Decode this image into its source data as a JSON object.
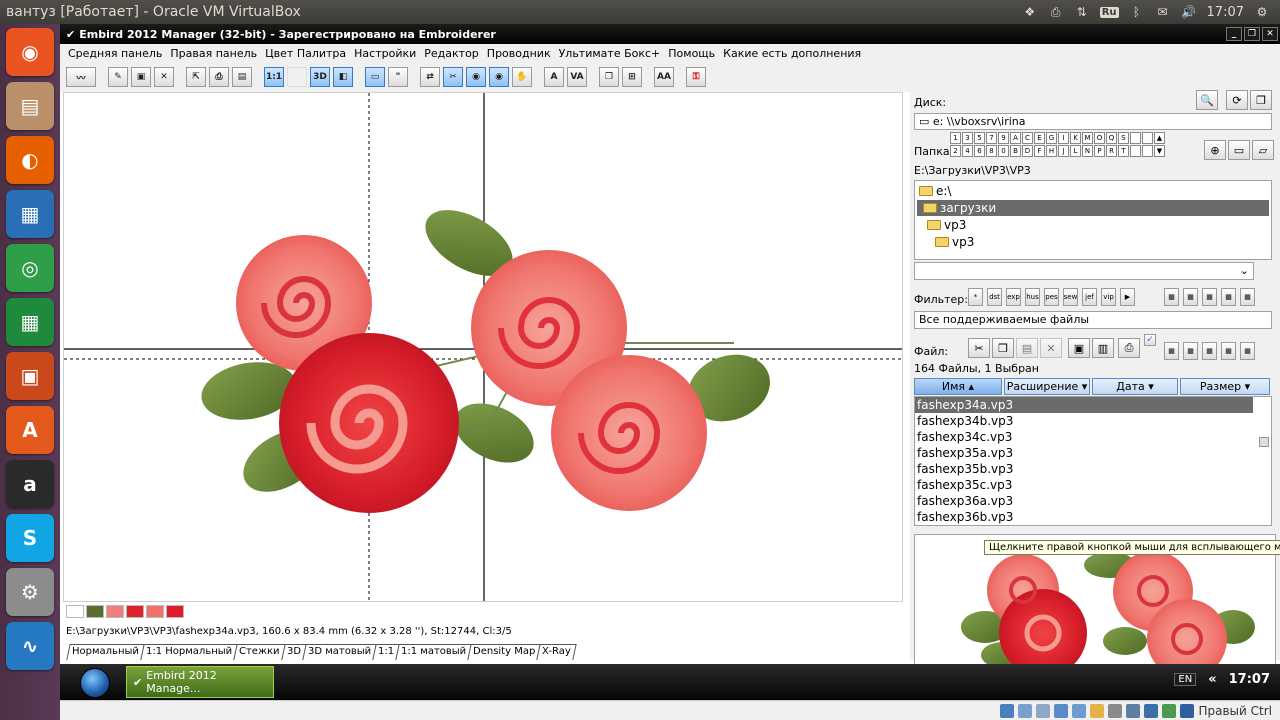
{
  "host": {
    "window_title": "вантуз [Работает] - Oracle VM VirtualBox",
    "keyboard_layout": "Ru",
    "clock": "17:07",
    "launcher_items": [
      {
        "name": "ubuntu-dash-icon",
        "color": "#e95420",
        "glyph": "◉"
      },
      {
        "name": "files-icon",
        "color": "#b9906a",
        "glyph": "▤"
      },
      {
        "name": "firefox-icon",
        "color": "#e66000",
        "glyph": "◐"
      },
      {
        "name": "writer-icon",
        "color": "#2a6fb5",
        "glyph": "▦"
      },
      {
        "name": "chrome-icon",
        "color": "#2e9e48",
        "glyph": "◎"
      },
      {
        "name": "calc-icon",
        "color": "#1f8a3c",
        "glyph": "▦"
      },
      {
        "name": "impress-icon",
        "color": "#c9481c",
        "glyph": "▣"
      },
      {
        "name": "software-center-icon",
        "color": "#e45a1c",
        "glyph": "A"
      },
      {
        "name": "amazon-icon",
        "color": "#2a2a2a",
        "glyph": "a"
      },
      {
        "name": "skype-icon",
        "color": "#12a5e6",
        "glyph": "S"
      },
      {
        "name": "settings-icon",
        "color": "#8c8c8c",
        "glyph": "⚙"
      },
      {
        "name": "monitor-icon",
        "color": "#2579c2",
        "glyph": "∿"
      }
    ]
  },
  "app": {
    "title": "Embird 2012 Manager (32-bit) - Зарегестрировано на Embroiderer",
    "menu": [
      "Средняя панель",
      "Правая панель",
      "Цвет Палитра",
      "Настройки",
      "Редактор",
      "Проводник",
      "Ультимате Бокс+",
      "Помощь",
      "Какие есть дополнения"
    ],
    "toolbar_labels": {
      "one_to_one": "1:1",
      "three_d": "3D",
      "text_a": "A",
      "text_va": "VA",
      "text_aa": "AA"
    }
  },
  "design": {
    "palette": [
      "#ffffff",
      "#5c6e2e",
      "#f07e7a",
      "#e0222c",
      "#f26f6a",
      "#e01c2a"
    ],
    "file_info": "E:\\Загрузки\\VP3\\VP3\\fashexp34a.vp3, 160.6 x 83.4 mm (6.32 x 3.28 ''), St:12744, Cl:3/5",
    "view_tabs": [
      "Нормальный",
      "1:1 Нормальный",
      "Стежки",
      "3D",
      "3D матовый",
      "1:1",
      "1:1 матовый",
      "Density Map",
      "X-Ray"
    ]
  },
  "panel": {
    "disk_label": "Диск:",
    "disk_value": "e: \\\\vboxsrv\\irina",
    "folder_label": "Папка:",
    "folder_keys_row1": [
      "1",
      "3",
      "5",
      "7",
      "9",
      "A",
      "C",
      "E",
      "G",
      "I",
      "K",
      "M",
      "O",
      "Q",
      "S"
    ],
    "folder_keys_row2": [
      "2",
      "4",
      "6",
      "8",
      "0",
      "B",
      "D",
      "F",
      "H",
      "J",
      "L",
      "N",
      "P",
      "R",
      "T"
    ],
    "path": "E:\\Загрузки\\VP3\\VP3",
    "tree": [
      {
        "label": "e:\\",
        "indent": 0,
        "selected": false
      },
      {
        "label": "загрузки",
        "indent": 1,
        "selected": true
      },
      {
        "label": "vp3",
        "indent": 1,
        "selected": false
      },
      {
        "label": "vp3",
        "indent": 2,
        "selected": false
      }
    ],
    "filter_label": "Фильтер:",
    "filter_buttons": [
      "*",
      "dst",
      "exp",
      "hus",
      "pes",
      "sew",
      "jef",
      "vip"
    ],
    "filter_value": "Все поддерживаемые файлы",
    "file_label": "Файл:",
    "count": "164 Файлы, 1 Выбран",
    "columns": [
      "Имя ▴",
      "Расширение ▾",
      "Дата ▾",
      "Размер ▾"
    ],
    "files": [
      {
        "name": "fashexp34a.vp3",
        "selected": true
      },
      {
        "name": "fashexp34b.vp3",
        "selected": false
      },
      {
        "name": "fashexp34c.vp3",
        "selected": false
      },
      {
        "name": "fashexp35a.vp3",
        "selected": false
      },
      {
        "name": "fashexp35b.vp3",
        "selected": false
      },
      {
        "name": "fashexp35c.vp3",
        "selected": false
      },
      {
        "name": "fashexp36a.vp3",
        "selected": false
      },
      {
        "name": "fashexp36b.vp3",
        "selected": false
      }
    ],
    "tooltip": "Щелкните правой кнопкой мыши для всплывающего меню"
  },
  "guest_taskbar": {
    "task_label": "Embird 2012 Manage...",
    "lang": "EN",
    "clock": "17:07"
  },
  "vbox_status": {
    "host_key": "Правый Ctrl"
  }
}
